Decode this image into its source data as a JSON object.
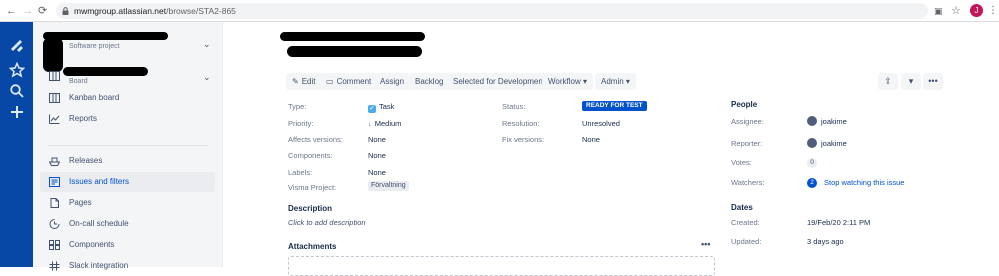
{
  "browser": {
    "back": "←",
    "forward": "→",
    "reload": "⟳",
    "url_host": "mwmgroup.atlassian.net",
    "url_path": "/browse/STA2-865",
    "profile_initial": "J"
  },
  "sidebar": {
    "project_type": "Software project",
    "board_type": "Board",
    "items": [
      {
        "label": "Kanban board"
      },
      {
        "label": "Reports"
      },
      {
        "label": "Releases"
      },
      {
        "label": "Issues and filters"
      },
      {
        "label": "Pages"
      },
      {
        "label": "On-call schedule"
      },
      {
        "label": "Components"
      },
      {
        "label": "Slack integration"
      }
    ]
  },
  "toolbar": {
    "edit": "Edit",
    "comment": "Comment",
    "assign": "Assign",
    "backlog": "Backlog",
    "selected": "Selected for Development",
    "workflow": "Workflow",
    "admin": "Admin"
  },
  "details": {
    "type_label": "Type:",
    "type_value": "Task",
    "priority_label": "Priority:",
    "priority_value": "Medium",
    "affects_label": "Affects versions:",
    "affects_value": "None",
    "components_label": "Components:",
    "components_value": "None",
    "labels_label": "Labels:",
    "labels_value": "None",
    "visma_label": "Visma Project:",
    "visma_value": "Förvaltning",
    "status_label": "Status:",
    "status_value": "READY FOR TEST",
    "resolution_label": "Resolution:",
    "resolution_value": "Unresolved",
    "fix_label": "Fix versions:",
    "fix_value": "None"
  },
  "description": {
    "heading": "Description",
    "placeholder": "Click to add description"
  },
  "attachments": {
    "heading": "Attachments"
  },
  "people": {
    "heading": "People",
    "assignee_label": "Assignee:",
    "assignee": "joakime",
    "reporter_label": "Reporter:",
    "reporter": "joakime",
    "votes_label": "Votes:",
    "votes": "0",
    "watchers_label": "Watchers:",
    "watchers": "2",
    "watch_link": "Stop watching this issue"
  },
  "dates": {
    "heading": "Dates",
    "created_label": "Created:",
    "created": "19/Feb/20 2:11 PM",
    "updated_label": "Updated:",
    "updated": "3 days ago"
  },
  "colors": {
    "global_nav": "#0747a6",
    "status": "#0052cc",
    "link": "#0052cc"
  }
}
